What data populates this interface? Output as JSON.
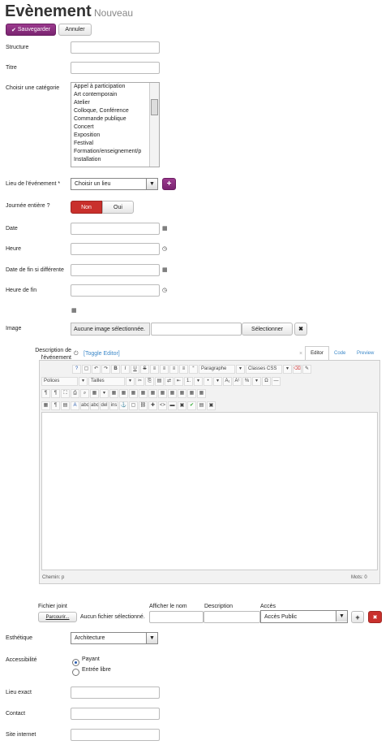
{
  "header": {
    "title": "Evènement",
    "subtitle": "Nouveau"
  },
  "toolbar": {
    "save_label": "Sauvegarder",
    "cancel_label": "Annuler"
  },
  "fields": {
    "structure": "Structure",
    "titre": "Titre",
    "categorie": "Choisir une catégorie",
    "lieu": "Lieu de l'événement *",
    "journee": "Journée entière ?",
    "date": "Date",
    "heure": "Heure",
    "date_fin": "Date de fin si différente",
    "heure_fin": "Heure de fin",
    "image": "Image",
    "description": "Description de l'événement",
    "esthetique": "Esthétique",
    "accessibilite": "Accessibilité",
    "lieu_exact": "Lieu exact",
    "contact": "Contact",
    "site": "Site internet"
  },
  "categories": [
    "Appel à participation",
    "Art contemporain",
    "Atelier",
    "Colloque, Conférence",
    "Commande publique",
    "Concert",
    "Exposition",
    "Festival",
    "Formation/enseignement/p",
    "Installation"
  ],
  "lieu_select": "Choisir un lieu",
  "journee": {
    "non": "Non",
    "oui": "Oui"
  },
  "image": {
    "none": "Aucune image sélectionnée.",
    "select": "Sélectionner"
  },
  "editor": {
    "toggle": "[Toggle Editor]",
    "tabs": [
      "Editor",
      "Code",
      "Preview"
    ],
    "paragraphe": "Paragraphe",
    "classes": "Classes CSS",
    "polices": "Polices",
    "tailles": "Tailles",
    "path_label": "Chemin:",
    "path_value": "p",
    "words_label": "Mots:",
    "words_value": "0"
  },
  "fichier": {
    "label": "Fichier joint",
    "browse": "Parcourir...",
    "none": "Aucun fichier sélectionné.",
    "afficher": "Afficher le nom",
    "description": "Description",
    "acces": "Accès",
    "acces_value": "Accès Public"
  },
  "esthetique_value": "Architecture",
  "access_options": [
    "Payant",
    "Entrée libre"
  ],
  "colors": {
    "accent": "#8a2b7e",
    "danger": "#c9302c"
  }
}
